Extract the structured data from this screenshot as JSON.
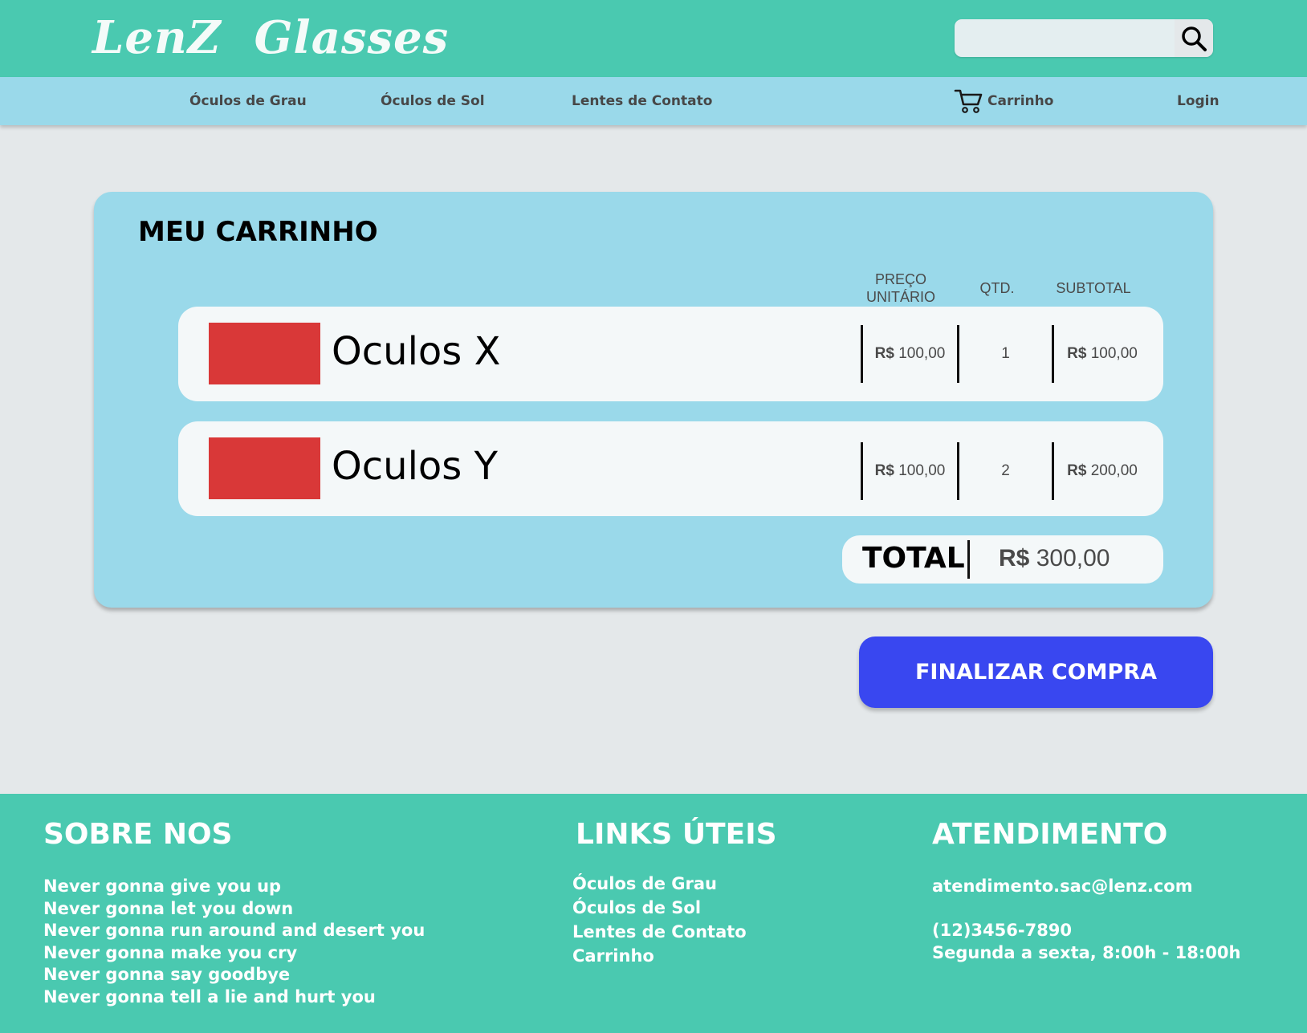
{
  "brand": {
    "logo": "LenZ  Glasses"
  },
  "search": {
    "placeholder": "",
    "value": "",
    "icon": "search-icon"
  },
  "nav": {
    "items": [
      {
        "label": "Óculos de Grau"
      },
      {
        "label": "Óculos de Sol"
      },
      {
        "label": "Lentes de Contato"
      }
    ],
    "cart": {
      "label": "Carrinho",
      "icon": "cart-icon"
    },
    "login": {
      "label": "Login"
    }
  },
  "cart": {
    "title": "MEU CARRINHO",
    "columns": {
      "unit_price_line1": "PREÇO",
      "unit_price_line2": "UNITÁRIO",
      "qty": "QTD.",
      "subtotal": "SUBTOTAL"
    },
    "currency": "R$",
    "items": [
      {
        "name": "Oculos X",
        "unit_price": "100,00",
        "qty": "1",
        "subtotal": "100,00"
      },
      {
        "name": "Oculos Y",
        "unit_price": "100,00",
        "qty": "2",
        "subtotal": "200,00"
      }
    ],
    "total_label": "TOTAL",
    "total_value": "300,00"
  },
  "checkout": {
    "label": "FINALIZAR COMPRA"
  },
  "footer": {
    "about": {
      "heading": "SOBRE NOS",
      "lines": [
        "Never gonna give you up",
        "Never gonna let you down",
        "Never gonna run around and desert you",
        "Never gonna make you cry",
        "Never gonna say goodbye",
        "Never gonna tell a lie and hurt you"
      ]
    },
    "links": {
      "heading": "LINKS ÚTEIS",
      "items": [
        "Óculos de Grau",
        "Óculos de Sol",
        "Lentes de Contato",
        "Carrinho"
      ]
    },
    "support": {
      "heading": "ATENDIMENTO",
      "email": "atendimento.sac@lenz.com",
      "phone": "(12)3456-7890",
      "hours": "Segunda a sexta, 8:00h - 18:00h"
    }
  },
  "colors": {
    "header": "#4ac9b0",
    "navbar": "#9ad9ea",
    "background": "#e4e8ea",
    "cart_panel": "#9ad9ea",
    "row": "#f4f8f9",
    "thumbnail": "#d93838",
    "checkout_button": "#3947f0"
  }
}
